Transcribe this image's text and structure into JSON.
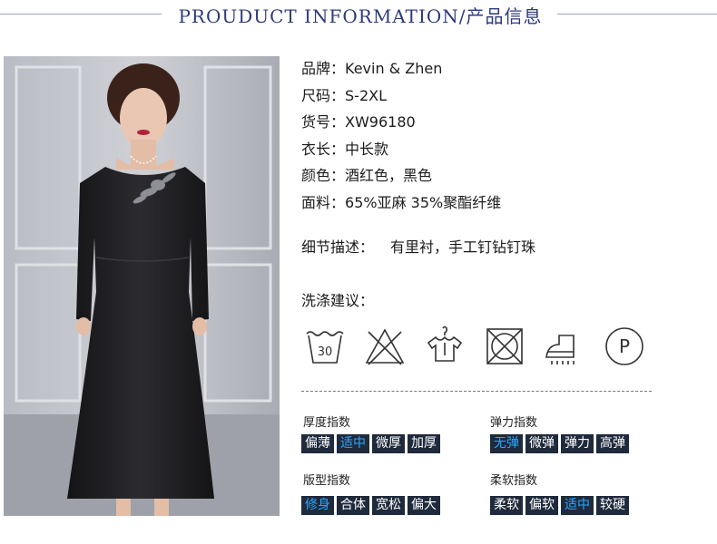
{
  "header": {
    "title": "PROUDUCT INFORMATION/产品信息"
  },
  "info": [
    {
      "label": "品牌：",
      "value": "Kevin & Zhen"
    },
    {
      "label": "尺码：",
      "value": "S-2XL"
    },
    {
      "label": "货号：",
      "value": "XW96180"
    },
    {
      "label": "衣长：",
      "value": "中长款"
    },
    {
      "label": "颜色：",
      "value": "酒红色，黑色"
    },
    {
      "label": "面料：",
      "value": "65%亚麻 35%聚酯纤维"
    }
  ],
  "detail": {
    "label": "细节描述：",
    "value": "有里衬，手工钉钻钉珠"
  },
  "wash": {
    "title": "洗涤建议：",
    "icons": [
      "wash-30-icon",
      "do-not-bleach-icon",
      "hang-dry-icon",
      "do-not-tumble-dry-icon",
      "iron-steam-icon",
      "professional-dry-clean-icon"
    ],
    "temperature": "30",
    "dry_clean_letter": "P"
  },
  "indices": [
    {
      "title": "厚度指数",
      "options": [
        "偏薄",
        "适中",
        "微厚",
        "加厚"
      ],
      "selected": "适中"
    },
    {
      "title": "弹力指数",
      "options": [
        "无弹",
        "微弹",
        "弹力",
        "高弹"
      ],
      "selected": "无弹"
    },
    {
      "title": "版型指数",
      "options": [
        "修身",
        "合体",
        "宽松",
        "偏大"
      ],
      "selected": "修身"
    },
    {
      "title": "柔软指数",
      "options": [
        "柔软",
        "偏软",
        "适中",
        "较硬"
      ],
      "selected": "适中"
    }
  ],
  "colors": {
    "title": "#2e3a78",
    "option_bg": "#1f2a3c",
    "option_text": "#ffffff",
    "option_selected": "#2aa8ff"
  }
}
